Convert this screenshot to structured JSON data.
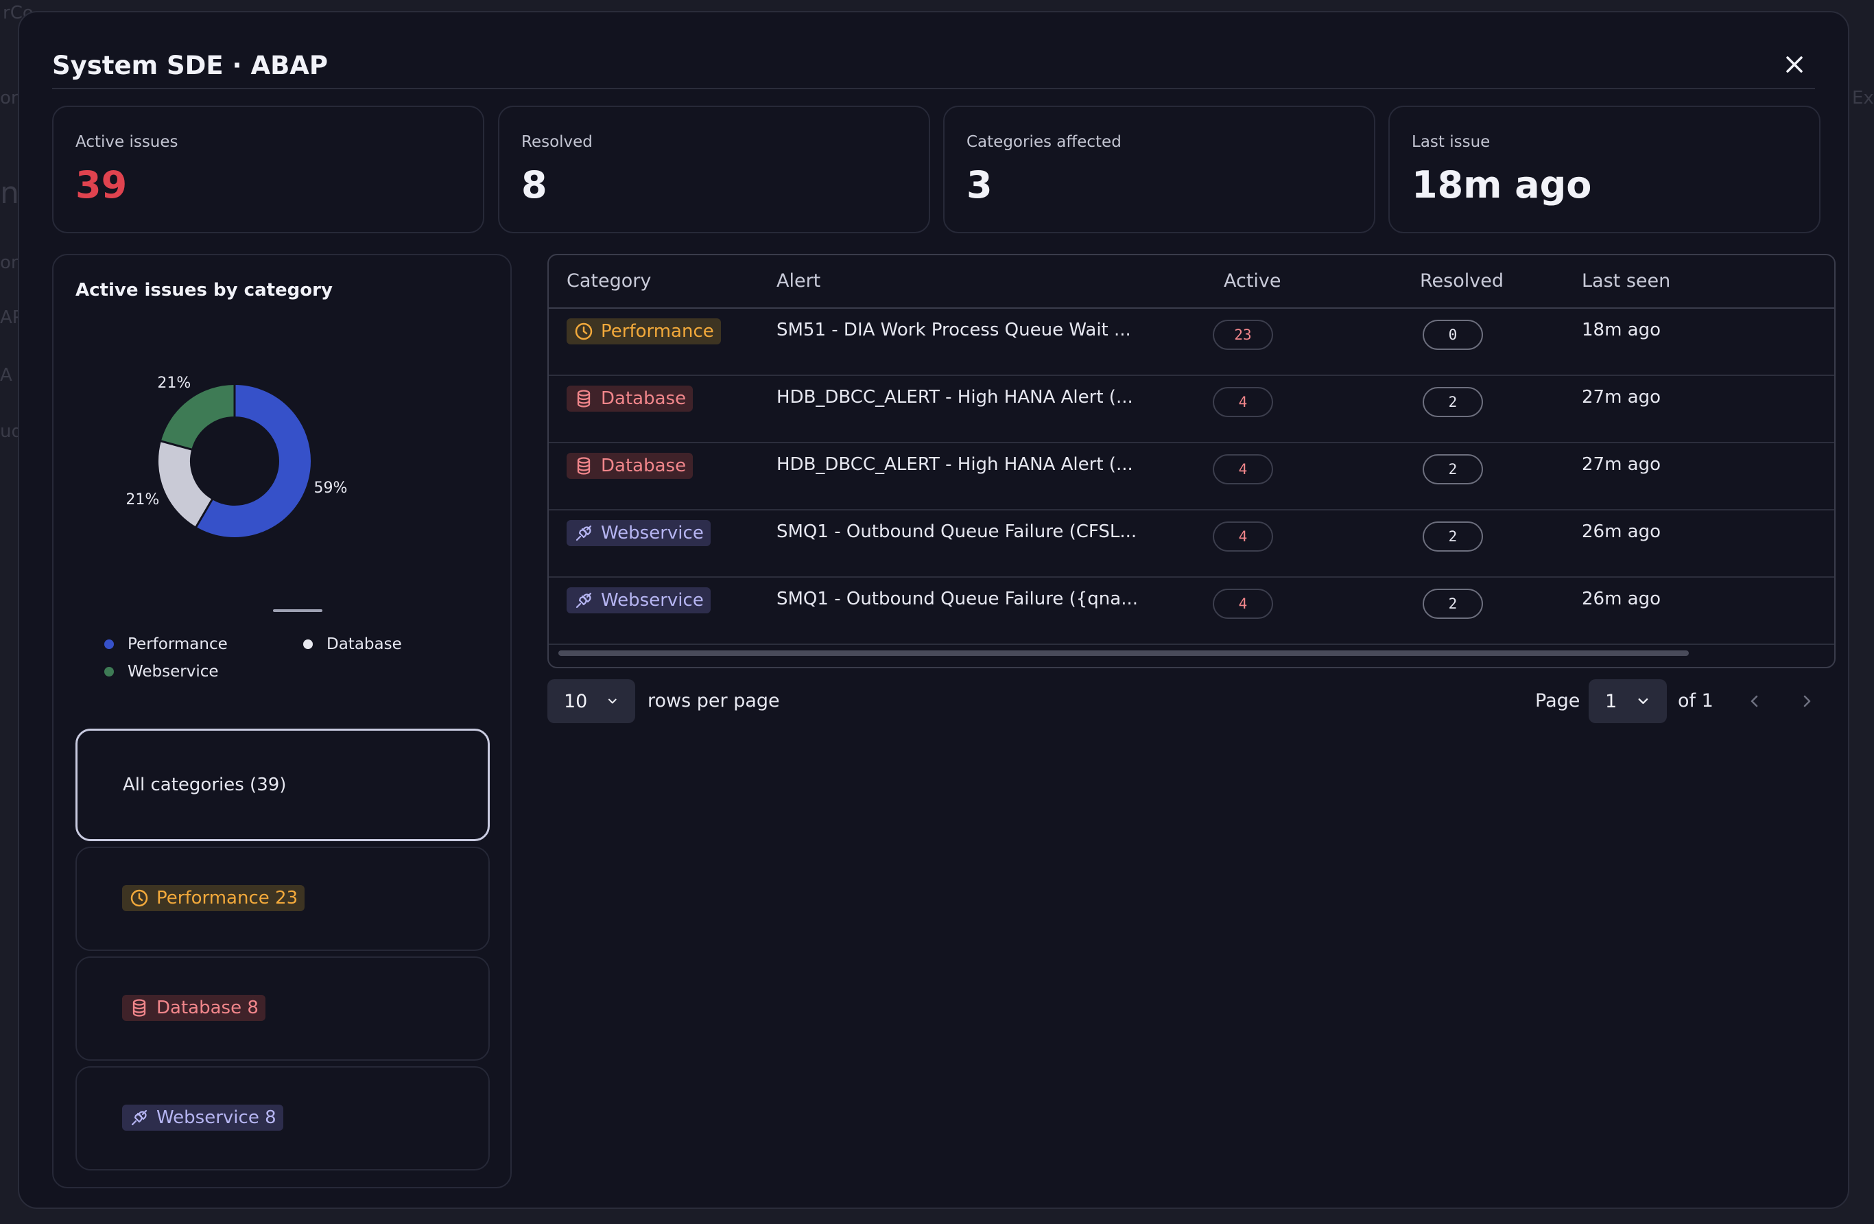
{
  "modal": {
    "title": "System SDE · ABAP"
  },
  "kpis": [
    {
      "label": "Active issues",
      "value": "39"
    },
    {
      "label": "Resolved",
      "value": "8"
    },
    {
      "label": "Categories affected",
      "value": "3"
    },
    {
      "label": "Last issue",
      "value": "18m ago"
    }
  ],
  "chart": {
    "title": "Active issues by category",
    "chart_data": {
      "type": "pie",
      "categories": [
        "Performance",
        "Database",
        "Webservice"
      ],
      "values": [
        59,
        21,
        21
      ],
      "labels": [
        "59%",
        "21%",
        "21%"
      ],
      "colors": [
        "#3651c9",
        "#c9cad6",
        "#3e7b55"
      ],
      "legend": "bottom"
    }
  },
  "legend": [
    {
      "label": "Performance",
      "color": "#3651c9"
    },
    {
      "label": "Database",
      "color": "#e8e9f0"
    },
    {
      "label": "Webservice",
      "color": "#3e7b55"
    }
  ],
  "filters": {
    "all": "All categories (39)",
    "items": [
      {
        "label": "Performance 23",
        "kind": "performance",
        "icon": "clock-icon"
      },
      {
        "label": "Database 8",
        "kind": "database",
        "icon": "database-icon"
      },
      {
        "label": "Webservice 8",
        "kind": "webservice",
        "icon": "link-icon"
      }
    ]
  },
  "table": {
    "headers": [
      "Category",
      "Alert",
      "Active",
      "Resolved",
      "Last seen"
    ],
    "rows": [
      {
        "category": "Performance",
        "alert": "SM51 - DIA Work Process Queue Wait ...",
        "active": "23",
        "resolved": "0",
        "last_seen": "18m ago"
      },
      {
        "category": "Database",
        "alert": "HDB_DBCC_ALERT - High HANA Alert (...",
        "active": "4",
        "resolved": "2",
        "last_seen": "27m ago"
      },
      {
        "category": "Database",
        "alert": "HDB_DBCC_ALERT - High HANA Alert (...",
        "active": "4",
        "resolved": "2",
        "last_seen": "27m ago"
      },
      {
        "category": "Webservice",
        "alert": "SMQ1 - Outbound Queue Failure (CFSL...",
        "active": "4",
        "resolved": "2",
        "last_seen": "26m ago"
      },
      {
        "category": "Webservice",
        "alert": "SMQ1 - Outbound Queue Failure ({qna...",
        "active": "4",
        "resolved": "2",
        "last_seen": "26m ago"
      }
    ]
  },
  "pager": {
    "rows_per_page": "10",
    "rows_per_page_label": "rows per page",
    "page_label": "Page",
    "page": "1",
    "of_label": "of 1"
  },
  "background": {
    "fragments": [
      "rCo",
      "orl",
      "n",
      "on",
      "AP",
      "A",
      "ud",
      "Ex"
    ]
  },
  "colors": {
    "accent_red": "#e0434f",
    "performance": "#f2a93b",
    "database": "#f1868b",
    "webservice": "#b6b5f2"
  }
}
